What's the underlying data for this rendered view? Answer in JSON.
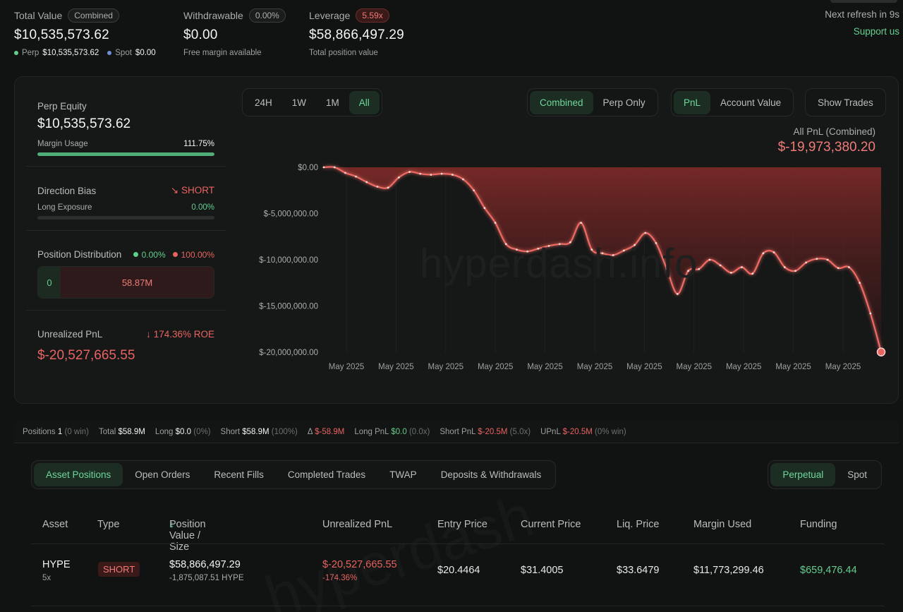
{
  "header": {
    "total_value": {
      "label": "Total Value",
      "badge": "Combined",
      "value": "$10,535,573.62",
      "perp_label": "Perp",
      "perp_value": "$10,535,573.62",
      "spot_label": "Spot",
      "spot_value": "$0.00"
    },
    "withdrawable": {
      "label": "Withdrawable",
      "badge": "0.00%",
      "value": "$0.00",
      "sub": "Free margin available"
    },
    "leverage": {
      "label": "Leverage",
      "badge": "5.59x",
      "value": "$58,866,497.29",
      "sub": "Total position value"
    },
    "refresh": "Next refresh in 9s",
    "support": "Support us"
  },
  "left": {
    "perp_equity_label": "Perp Equity",
    "perp_equity_value": "$10,535,573.62",
    "margin_usage_label": "Margin Usage",
    "margin_usage_value": "111.75%",
    "margin_usage_fill": 1.0,
    "direction_label": "Direction Bias",
    "direction_value": "SHORT",
    "long_exposure_label": "Long Exposure",
    "long_exposure_value": "0.00%",
    "long_exposure_fill": 0.0,
    "distribution_label": "Position Distribution",
    "dist_long_pct": "0.00%",
    "dist_short_pct": "100.00%",
    "dist_long_value": "0",
    "dist_short_value": "58.87M",
    "upnl_label": "Unrealized PnL",
    "upnl_roe": "174.36% ROE",
    "upnl_value": "$-20,527,665.55"
  },
  "controls": {
    "ranges": [
      "24H",
      "1W",
      "1M",
      "All"
    ],
    "range_active": 3,
    "modes": [
      "Combined",
      "Perp Only"
    ],
    "metrics": [
      "PnL",
      "Account Value"
    ],
    "show_trades": "Show Trades"
  },
  "chart_title": {
    "label": "All PnL (Combined)",
    "value": "$-19,973,380.20"
  },
  "watermark": "hyperdash.info",
  "colors": {
    "accent_green": "#5fcf8f",
    "negative_red": "#e8635f",
    "background": "#111312"
  },
  "chart_data": {
    "type": "area",
    "ylim": [
      -20000000,
      0
    ],
    "yticks": [
      "$0.00",
      "$-5,000,000.00",
      "$-10,000,000.00",
      "$-15,000,000.00",
      "$-20,000,000.00"
    ],
    "ytick_values": [
      0,
      -5000000,
      -10000000,
      -15000000,
      -20000000
    ],
    "xticks": [
      "May 2025",
      "May 2025",
      "May 2025",
      "May 2025",
      "May 2025",
      "May 2025",
      "May 2025",
      "May 2025",
      "May 2025",
      "May 2025",
      "May 2025"
    ],
    "values": [
      0,
      0,
      -600000,
      -1000000,
      -1600000,
      -2100000,
      -2200000,
      -1100000,
      -500000,
      -700000,
      -800000,
      -700000,
      -800000,
      -1300000,
      -2500000,
      -4400000,
      -6000000,
      -8300000,
      -8900000,
      -9100000,
      -8800000,
      -8500000,
      -8300000,
      -8100000,
      -6000000,
      -8900000,
      -9300000,
      -9500000,
      -9000000,
      -8400000,
      -7100000,
      -8200000,
      -11000000,
      -13700000,
      -11200000,
      -11000000,
      -10000000,
      -10600000,
      -11400000,
      -10800000,
      -11500000,
      -9300000,
      -9200000,
      -10800000,
      -11200000,
      -10300000,
      -9900000,
      -10000000,
      -10900000,
      -10800000,
      -12500000,
      -15800000,
      -19973380
    ]
  },
  "summary": {
    "positions_label": "Positions",
    "positions_value": "1",
    "positions_note": "(0 win)",
    "total_label": "Total",
    "total_value": "$58.9M",
    "long_label": "Long",
    "long_value": "$0.0",
    "long_note": "(0%)",
    "short_label": "Short",
    "short_value": "$58.9M",
    "short_note": "(100%)",
    "delta_label": "Δ",
    "delta_value": "$-58.9M",
    "long_pnl_label": "Long PnL",
    "long_pnl_value": "$0.0",
    "long_pnl_note": "(0.0x)",
    "short_pnl_label": "Short PnL",
    "short_pnl_value": "$-20.5M",
    "short_pnl_note": "(5.0x)",
    "upnl_label": "UPnL",
    "upnl_value": "$-20.5M",
    "upnl_note": "(0% win)"
  },
  "tabs": [
    "Asset Positions",
    "Open Orders",
    "Recent Fills",
    "Completed Trades",
    "TWAP",
    "Deposits & Withdrawals"
  ],
  "tab_active": 0,
  "market_tabs": [
    "Perpetual",
    "Spot"
  ],
  "table": {
    "headers": [
      "Asset",
      "Type",
      "Position Value / Size",
      "Unrealized PnL",
      "Entry Price",
      "Current Price",
      "Liq. Price",
      "Margin Used",
      "Funding"
    ],
    "row": {
      "asset": "HYPE",
      "leverage": "5x",
      "type": "SHORT",
      "position_value": "$58,866,497.29",
      "size": "-1,875,087.51 HYPE",
      "upnl": "$-20,527,665.55",
      "upnl_pct": "-174.36%",
      "entry": "$20.4464",
      "current": "$31.4005",
      "liq": "$33.6479",
      "margin": "$11,773,299.46",
      "funding": "$659,476.44"
    }
  },
  "watermark2": "hyperdash"
}
